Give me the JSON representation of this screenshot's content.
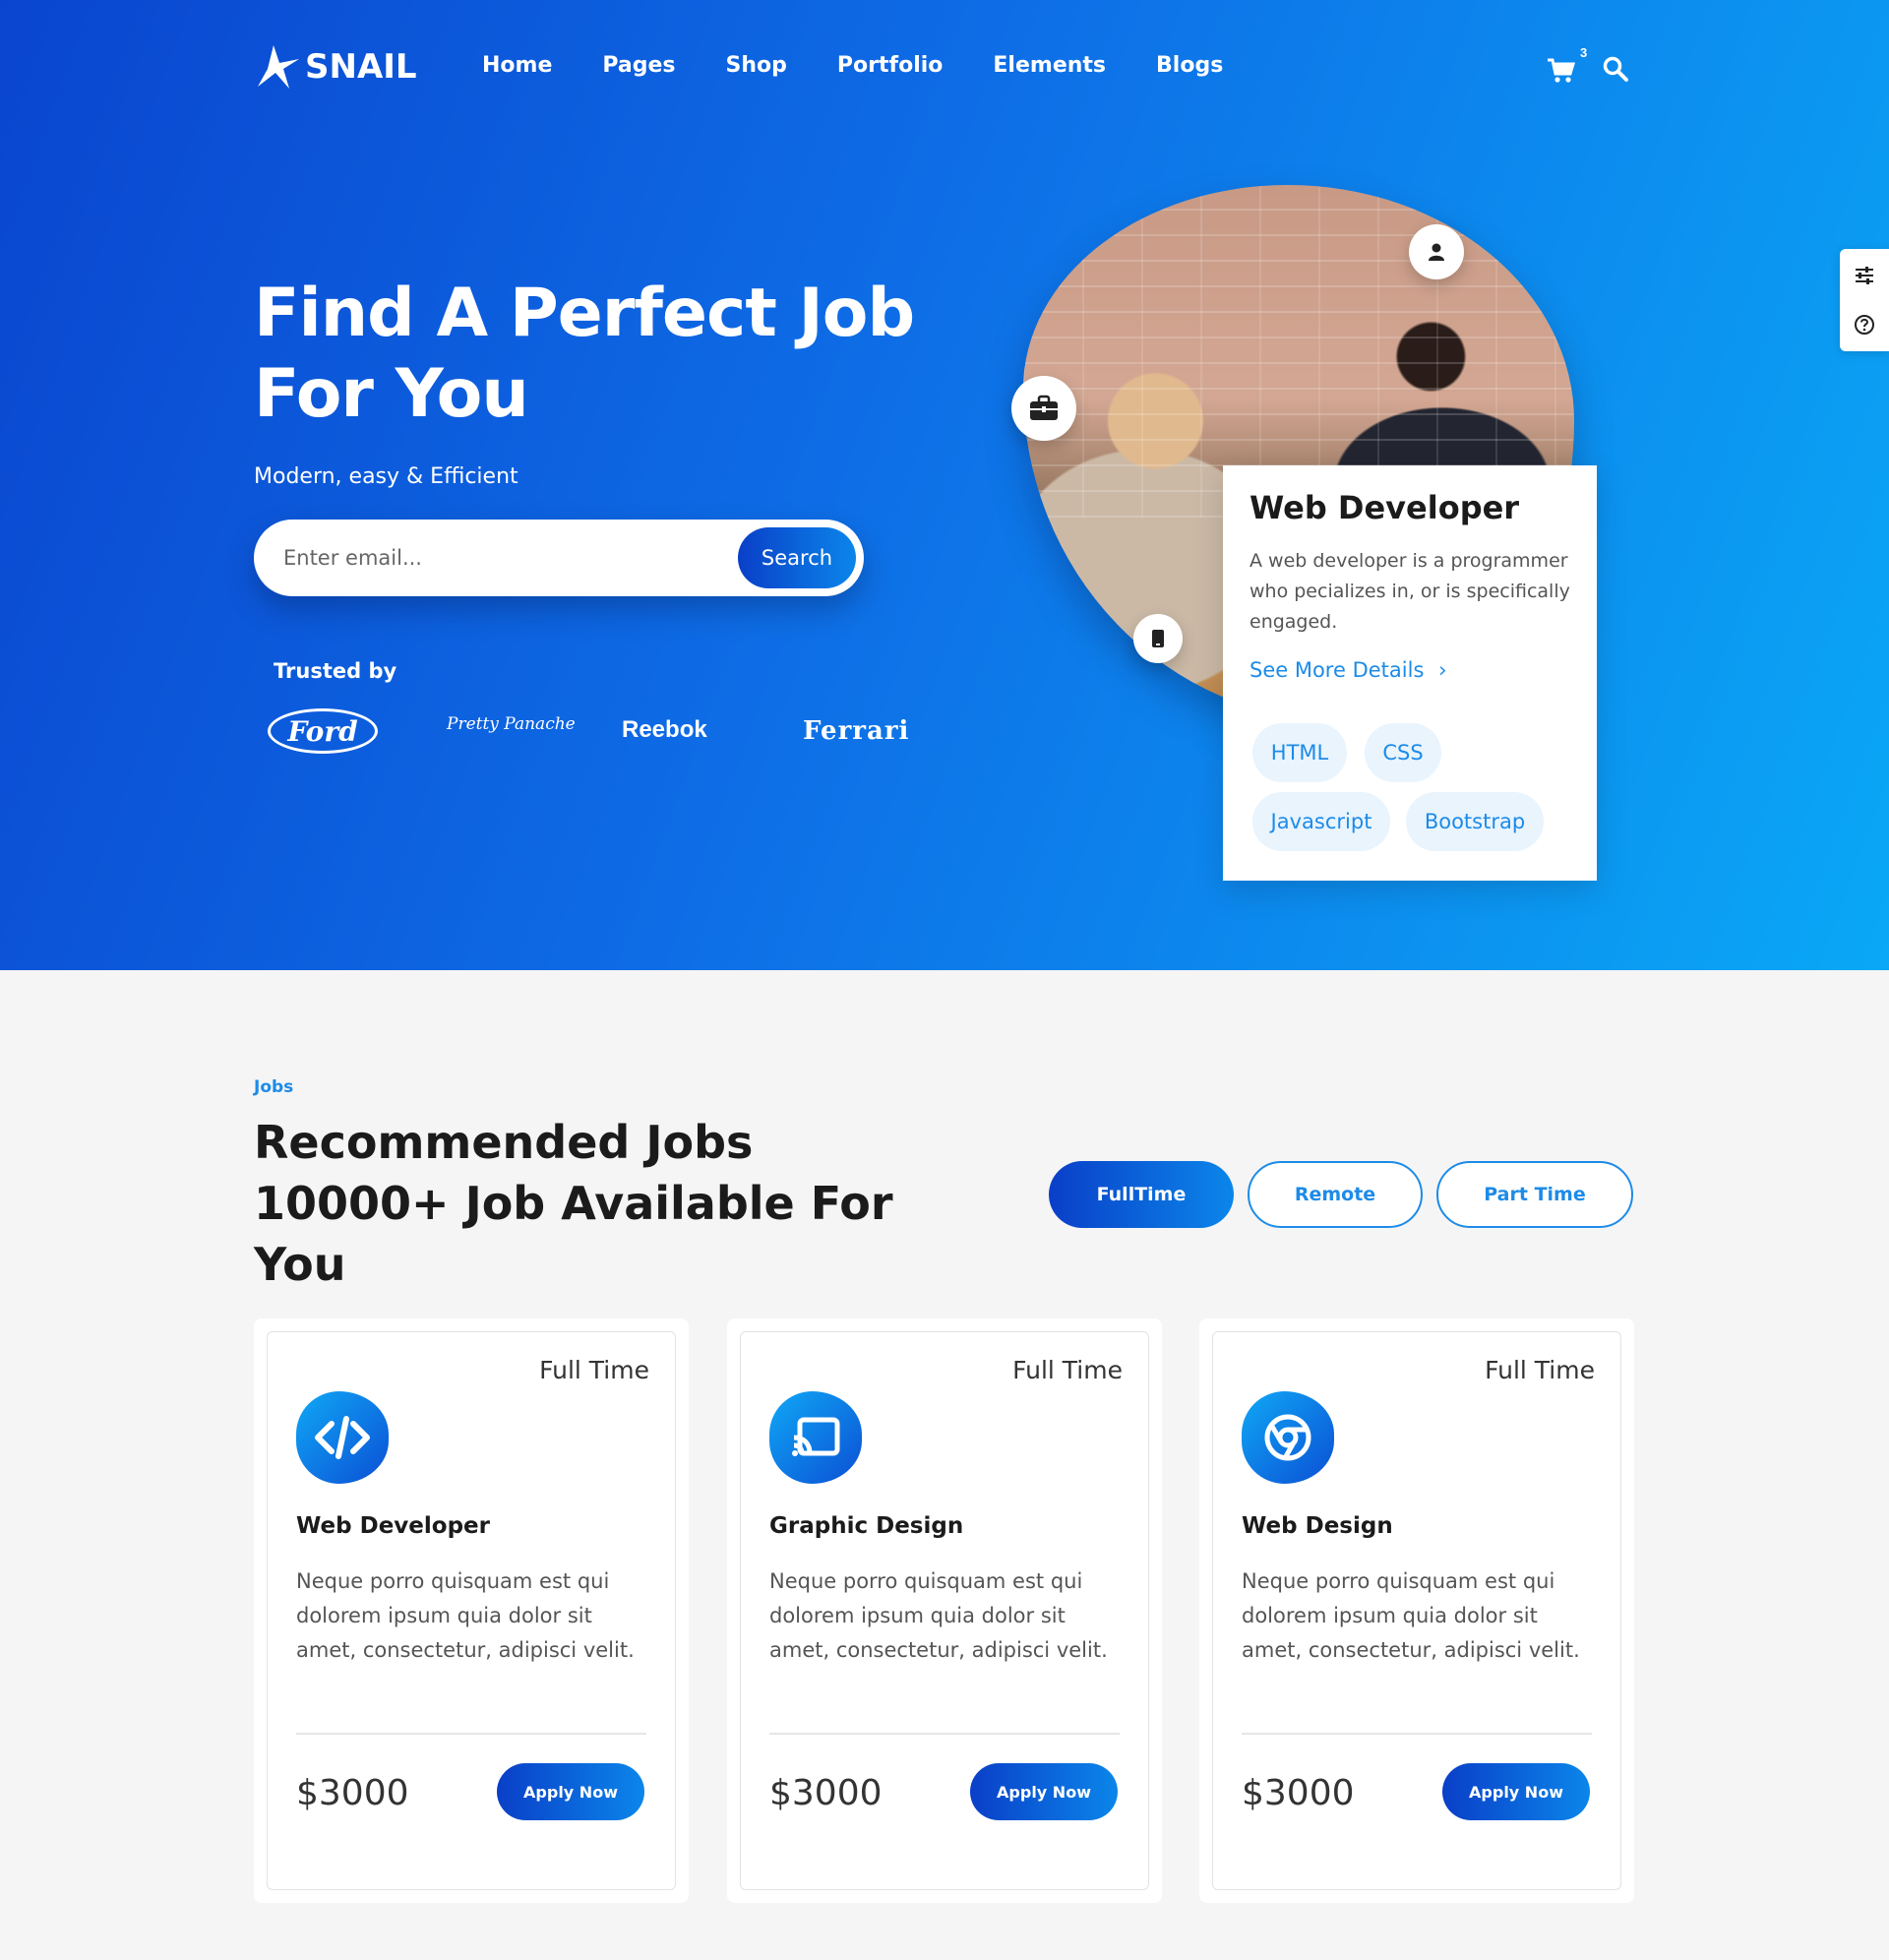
{
  "brand": {
    "name": "SNAIL"
  },
  "nav": {
    "items": [
      "Home",
      "Pages",
      "Shop",
      "Portfolio",
      "Elements",
      "Blogs"
    ],
    "cart_count": "3",
    "cart_icon": "cart-icon",
    "search_icon": "search-icon"
  },
  "hero": {
    "title": "Find A Perfect Job For You",
    "subtitle": "Modern, easy & Efficient",
    "search": {
      "placeholder": "Enter email...",
      "button": "Search"
    },
    "trusted_label": "Trusted by",
    "brands": [
      "Ford",
      "Pretty Panache",
      "Reebok",
      "Ferrari"
    ]
  },
  "featured_job": {
    "title": "Web Developer",
    "description": "A web developer is a programmer who pecializes in, or is specifically engaged.",
    "link": "See More Details",
    "tags": [
      "HTML",
      "CSS",
      "Javascript",
      "Bootstrap"
    ]
  },
  "jobs_section": {
    "label": "Jobs",
    "title": "Recommended Jobs 10000+ Job Available For You",
    "filters": [
      "FullTime",
      "Remote",
      "Part Time"
    ],
    "active_filter": "FullTime",
    "cards": [
      {
        "type": "Full Time",
        "icon": "code-icon",
        "title": "Web Developer",
        "description": "Neque porro quisquam est qui dolorem ipsum quia dolor sit amet, consectetur, adipisci velit.",
        "price": "$3000",
        "button": "Apply Now"
      },
      {
        "type": "Full Time",
        "icon": "cast-icon",
        "title": "Graphic Design",
        "description": "Neque porro quisquam est qui dolorem ipsum quia dolor sit amet, consectetur, adipisci velit.",
        "price": "$3000",
        "button": "Apply Now"
      },
      {
        "type": "Full Time",
        "icon": "chrome-icon",
        "title": "Web Design",
        "description": "Neque porro quisquam est qui dolorem ipsum quia dolor sit amet, consectetur, adipisci velit.",
        "price": "$3000",
        "button": "Apply Now"
      }
    ]
  },
  "colors": {
    "accent": "#1d8be8",
    "gradient_start": "#0a3fc8",
    "gradient_end": "#0aa8f6"
  }
}
